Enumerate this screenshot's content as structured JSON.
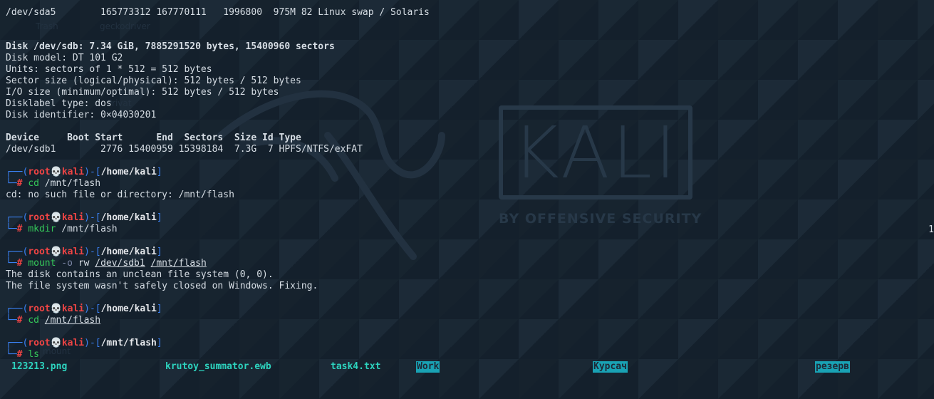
{
  "wallpaper": {
    "logo_text": "KALI",
    "tagline": "BY OFFENSIVE SECURITY",
    "ghost_icons": [
      "Trash",
      "geckodriver",
      "Privat",
      "mount"
    ]
  },
  "terminal": {
    "fdisk_tail": "/dev/sda5        165773312 167770111   1996800  975M 82 Linux swap / Solaris",
    "disk_header": "Disk /dev/sdb: 7.34 GiB, 7885291520 bytes, 15400960 sectors",
    "disk_model": "Disk model: DT 101 G2",
    "units": "Units: sectors of 1 * 512 = 512 bytes",
    "sector_size": "Sector size (logical/physical): 512 bytes / 512 bytes",
    "io_size": "I/O size (minimum/optimal): 512 bytes / 512 bytes",
    "disklabel": "Disklabel type: dos",
    "identifier": "Disk identifier: 0×04030201",
    "table_header": "Device     Boot Start      End  Sectors  Size Id Type",
    "table_row": "/dev/sdb1        2776 15400959 15398184  7.3G  7 HPFS/NTFS/exFAT",
    "prompt": {
      "frame_top": "┌──(",
      "user": "root",
      "skull": "💀",
      "host": "kali",
      "mid": ")-[",
      "close": "]",
      "frame_bottom": "└─",
      "hash": "#"
    },
    "blocks": [
      {
        "cwd": "/home/kali",
        "cmd": "cd",
        "args": " /mnt/flash",
        "output": [
          "cd: no such file or directory: /mnt/flash"
        ]
      },
      {
        "cwd": "/home/kali",
        "cmd": "mkdir",
        "args": " /mnt/flash",
        "output": []
      },
      {
        "cwd": "/home/kali",
        "cmd": "mount",
        "opt": " -o",
        "args_plain": " rw ",
        "arg_ul1": "/dev/sdb1",
        "arg_ul2": "/mnt/flash",
        "output": [
          "The disk contains an unclean file system (0, 0).",
          "The file system wasn't safely closed on Windows. Fixing."
        ]
      },
      {
        "cwd": "/home/kali",
        "cmd": "cd",
        "arg_ul": "/mnt/flash",
        "output": []
      },
      {
        "cwd": "/mnt/flash",
        "cmd": "ls",
        "output": []
      }
    ],
    "edge_char": "1",
    "ls": [
      {
        "name": "123213.png",
        "kind": "file"
      },
      {
        "name": "krutoy_summator.ewb",
        "kind": "file"
      },
      {
        "name": "task4.txt",
        "kind": "file"
      },
      {
        "name": "Work",
        "kind": "dir"
      },
      {
        "name": "Курсач",
        "kind": "dir"
      },
      {
        "name": "резерв",
        "kind": "dir"
      }
    ]
  }
}
